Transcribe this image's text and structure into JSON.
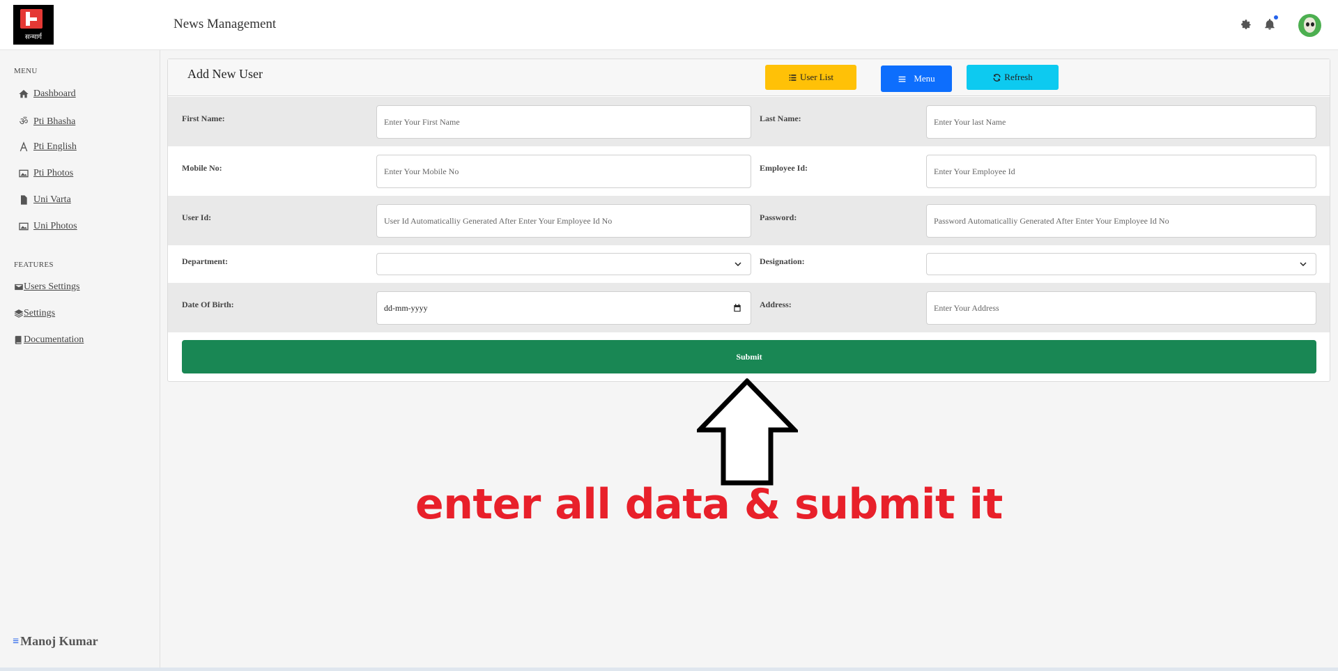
{
  "header": {
    "logo_text": "सन्मार्ग",
    "app_title": "News Management",
    "settings_icon": "gear-icon",
    "notifications_icon": "bell-icon",
    "accent": "#2563eb"
  },
  "sidebar": {
    "menu_heading": "MENU",
    "menu_items": [
      {
        "label": "Dashboard",
        "icon": "home-icon"
      },
      {
        "label": "Pti Bhasha",
        "icon": "om-icon"
      },
      {
        "label": "Pti English",
        "icon": "letter-a-icon"
      },
      {
        "label": "Pti Photos",
        "icon": "image-icon"
      },
      {
        "label": "Uni Varta",
        "icon": "file-icon"
      },
      {
        "label": "Uni Photos",
        "icon": "image-icon"
      }
    ],
    "features_heading": "FEATURES",
    "feature_items": [
      {
        "label": "Users Settings",
        "icon": "envelope-icon"
      },
      {
        "label": "Settings",
        "icon": "layers-icon"
      },
      {
        "label": "Documentation",
        "icon": "book-icon"
      }
    ],
    "user_name": "Manoj Kumar"
  },
  "form": {
    "title": "Add New User",
    "buttons": {
      "user_list": "User List",
      "menu": "Menu",
      "refresh": "Refresh"
    },
    "colors": {
      "user_list": "#ffc107",
      "menu": "#0d6efd",
      "refresh": "#0dcaf0",
      "submit": "#198754"
    },
    "fields": {
      "first_name_label": "First Name:",
      "first_name_placeholder": "Enter Your First Name",
      "last_name_label": "Last Name:",
      "last_name_placeholder": "Enter Your last Name",
      "mobile_label": "Mobile No:",
      "mobile_placeholder": "Enter Your Mobile No",
      "employee_id_label": "Employee Id:",
      "employee_id_placeholder": "Enter Your Employee Id",
      "user_id_label": "User Id:",
      "user_id_placeholder": "User Id Automaticalliy Generated After Enter Your Employee Id No",
      "password_label": "Password:",
      "password_placeholder": "Password Automaticalliy Generated After Enter Your Employee Id No",
      "department_label": "Department:",
      "department_value": "",
      "designation_label": "Designation:",
      "designation_value": "",
      "dob_label": "Date Of Birth:",
      "dob_value": "dd-mm-yyyy",
      "address_label": "Address:",
      "address_placeholder": "Enter Your Address"
    },
    "submit_label": "Submit"
  },
  "annotation": {
    "text": "enter all data & submit it",
    "color": "#e8202a"
  }
}
